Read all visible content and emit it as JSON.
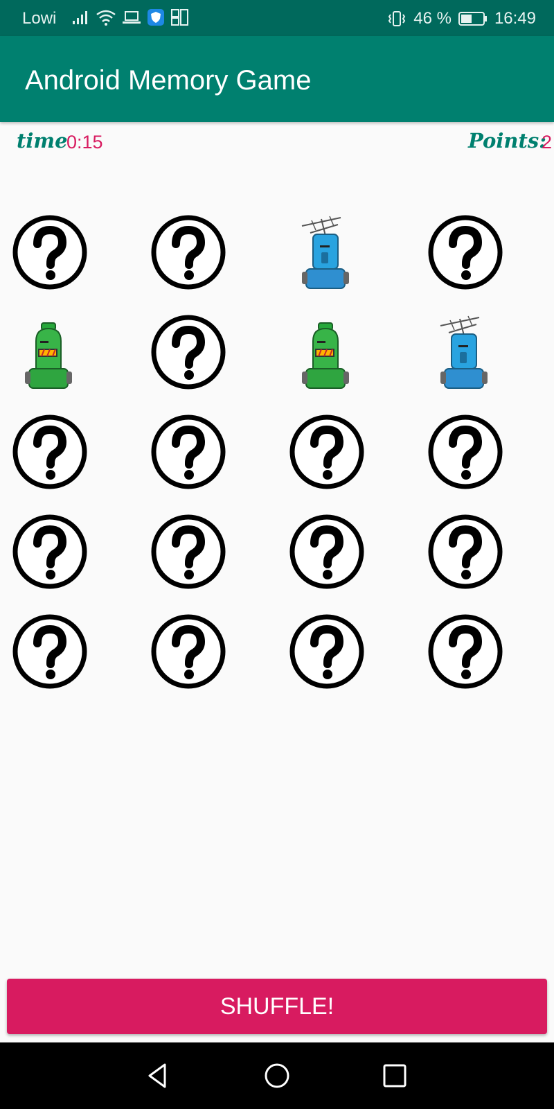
{
  "status_bar": {
    "carrier": "Lowi",
    "battery_percent": "46 %",
    "time": "16:49",
    "icons": [
      "signal-icon",
      "wifi-icon",
      "laptop-icon",
      "shield-app-icon",
      "sim-icon",
      "vibrate-icon",
      "battery-icon"
    ]
  },
  "app_bar": {
    "title": "Android Memory Game"
  },
  "info": {
    "time_label": "time",
    "time_value": "0:15",
    "points_label": "Points:",
    "points_value": "2"
  },
  "board": {
    "columns": 4,
    "rows": 5,
    "cards": [
      "hidden",
      "hidden",
      "blue-robot",
      "hidden",
      "green-robot",
      "hidden",
      "green-robot",
      "blue-robot",
      "hidden",
      "hidden",
      "hidden",
      "hidden",
      "hidden",
      "hidden",
      "hidden",
      "hidden",
      "hidden",
      "hidden",
      "hidden",
      "hidden"
    ]
  },
  "shuffle_label": "SHUFFLE!",
  "nav": {
    "icons": [
      "back-icon",
      "home-icon",
      "recents-icon"
    ]
  },
  "colors": {
    "status_bar": "#00695c",
    "app_bar": "#00806f",
    "accent": "#d81b60",
    "label": "#00806f"
  }
}
